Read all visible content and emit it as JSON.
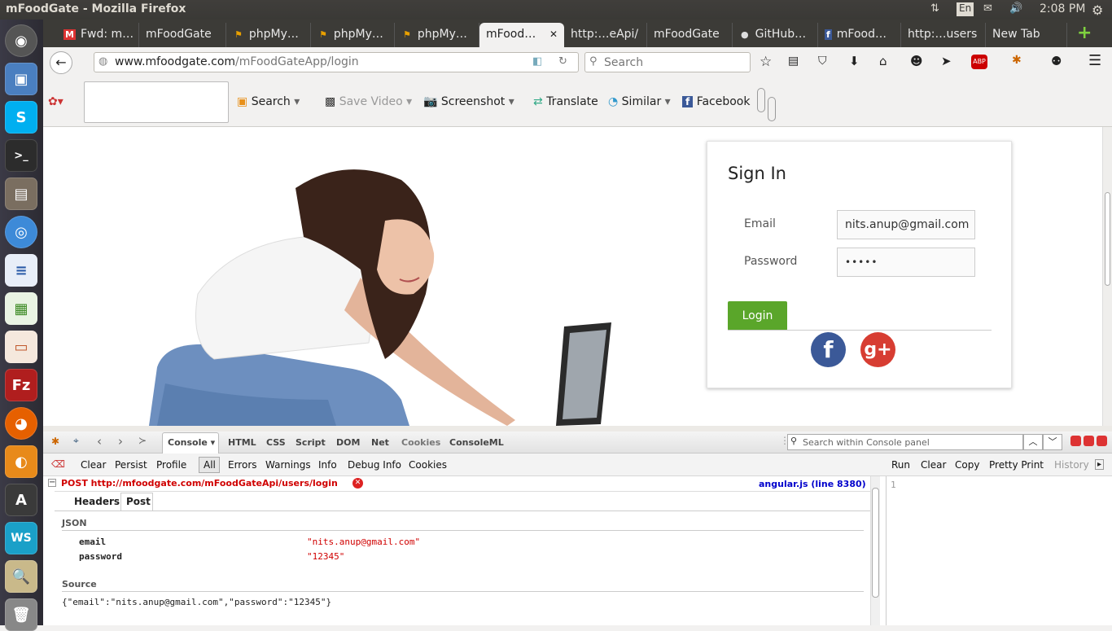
{
  "window": {
    "title": "mFoodGate - Mozilla Firefox",
    "time": "2:08 PM",
    "lang": "En"
  },
  "tabs": [
    {
      "label": "Fwd: m…",
      "icon": "gmail-icon"
    },
    {
      "label": "mFoodGate",
      "icon": ""
    },
    {
      "label": "phpMy…",
      "icon": "phpmyadmin-icon"
    },
    {
      "label": "phpMy…",
      "icon": "phpmyadmin-icon"
    },
    {
      "label": "phpMy…",
      "icon": "phpmyadmin-icon"
    },
    {
      "label": "mFood…",
      "icon": "",
      "active": true
    },
    {
      "label": "http:…eApi/",
      "icon": ""
    },
    {
      "label": "mFoodGate",
      "icon": ""
    },
    {
      "label": "GitHub…",
      "icon": "github-icon"
    },
    {
      "label": "mFood…",
      "icon": "facebook-icon"
    },
    {
      "label": "http:…users",
      "icon": ""
    },
    {
      "label": "New Tab",
      "icon": ""
    }
  ],
  "nav": {
    "url_domain": "www.mfoodgate.com",
    "url_path": "/mFoodGateApp/login",
    "search_placeholder": "Search"
  },
  "toolbar": {
    "search": "Search",
    "save_video": "Save Video",
    "screenshot": "Screenshot",
    "translate": "Translate",
    "similar": "Similar",
    "facebook": "Facebook"
  },
  "signin": {
    "title": "Sign In",
    "email_label": "Email",
    "email_value": "nits.anup@gmail.com",
    "password_label": "Password",
    "password_value": "•••••",
    "login": "Login"
  },
  "firebug": {
    "tabs": [
      "Console",
      "HTML",
      "CSS",
      "Script",
      "DOM",
      "Net",
      "Cookies",
      "ConsoleML"
    ],
    "search_placeholder": "Search within Console panel",
    "sub_left": [
      "Clear",
      "Persist",
      "Profile"
    ],
    "filters": [
      "All",
      "Errors",
      "Warnings",
      "Info",
      "Debug Info",
      "Cookies"
    ],
    "sub_right": [
      "Run",
      "Clear",
      "Copy",
      "Pretty Print",
      "History"
    ],
    "request": "POST http://mfoodgate.com/mFoodGateApi/users/login",
    "source_link": "angular.js (line 8380)",
    "req_tabs": [
      "Headers",
      "Post"
    ],
    "json_label": "JSON",
    "params": [
      {
        "key": "email",
        "value": "\"nits.anup@gmail.com\""
      },
      {
        "key": "password",
        "value": "\"12345\""
      }
    ],
    "source_label": "Source",
    "source": "{\"email\":\"nits.anup@gmail.com\",\"password\":\"12345\"}",
    "line_number": "1"
  },
  "colors": {
    "login": "#5aa62a",
    "error": "#d00000",
    "link": "#0000cc",
    "facebook": "#3b5998",
    "google": "#d73d32"
  }
}
